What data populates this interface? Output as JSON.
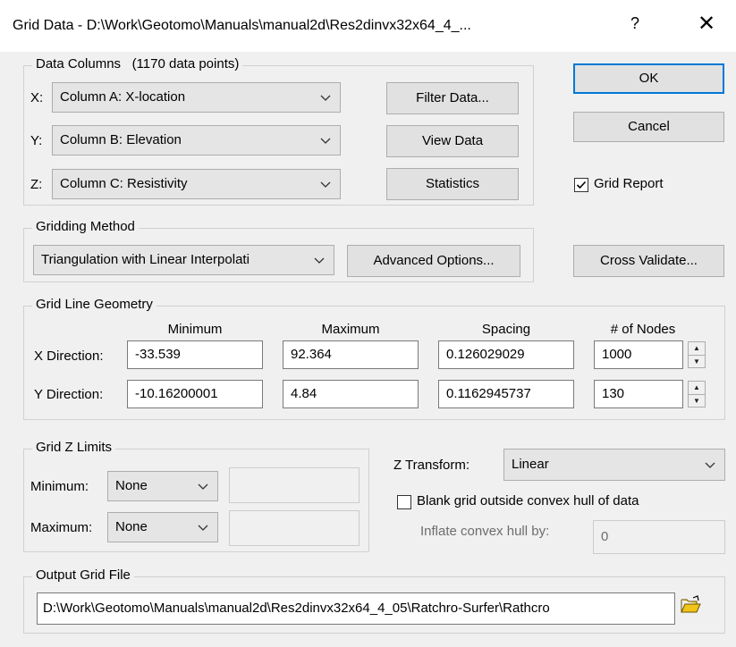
{
  "window": {
    "title": "Grid Data - D:\\Work\\Geotomo\\Manuals\\manual2d\\Res2dinvx32x64_4_...",
    "help": "?",
    "close": "✕"
  },
  "data_columns": {
    "title": "Data Columns",
    "count": "(1170 data points)",
    "rows": [
      {
        "axis": "X:",
        "value": "Column A:  X-location"
      },
      {
        "axis": "Y:",
        "value": "Column B:  Elevation"
      },
      {
        "axis": "Z:",
        "value": "Column C:  Resistivity"
      }
    ],
    "buttons": {
      "filter": "Filter Data...",
      "view": "View Data",
      "stats": "Statistics"
    }
  },
  "actions": {
    "ok": "OK",
    "cancel": "Cancel",
    "grid_report": "Grid Report",
    "grid_report_checked": true,
    "cross_validate": "Cross Validate..."
  },
  "gridding": {
    "title": "Gridding Method",
    "method": "Triangulation with Linear Interpolati",
    "advanced": "Advanced Options..."
  },
  "geometry": {
    "title": "Grid Line Geometry",
    "headers": {
      "min": "Minimum",
      "max": "Maximum",
      "spacing": "Spacing",
      "nodes": "# of Nodes"
    },
    "x": {
      "label": "X Direction:",
      "min": "-33.539",
      "max": "92.364",
      "spacing": "0.126029029",
      "nodes": "1000"
    },
    "y": {
      "label": "Y Direction:",
      "min": "-10.16200001",
      "max": "4.84",
      "spacing": "0.1162945737",
      "nodes": "130"
    }
  },
  "zlimits": {
    "title": "Grid Z Limits",
    "min_label": "Minimum:",
    "min_value": "None",
    "max_label": "Maximum:",
    "max_value": "None"
  },
  "transform": {
    "label": "Z Transform:",
    "value": "Linear"
  },
  "blank": {
    "label": "Blank grid outside convex hull of data",
    "checked": false,
    "inflate_label": "Inflate convex hull by:",
    "inflate_value": "0"
  },
  "output": {
    "title": "Output Grid File",
    "path": "D:\\Work\\Geotomo\\Manuals\\manual2d\\Res2dinvx32x64_4_05\\Ratchro-Surfer\\Rathcro"
  }
}
